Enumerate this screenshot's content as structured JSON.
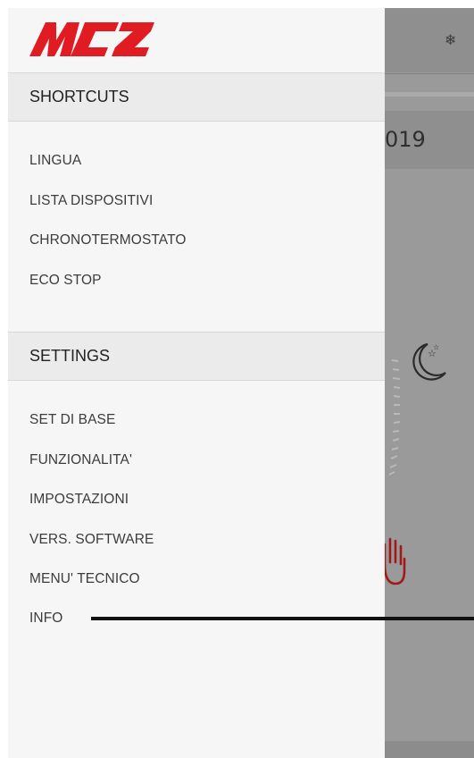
{
  "background": {
    "date_fragment": "019",
    "snow_icon": "snowflake-icon",
    "moon_icon": "moon-stars-icon",
    "hand_icon": "hand-stop-icon"
  },
  "drawer": {
    "logo_text": "MCZ",
    "brand_color": "#e11b22",
    "shortcuts": {
      "header": "SHORTCUTS",
      "items": [
        {
          "label": "LINGUA"
        },
        {
          "label": "LISTA DISPOSITIVI"
        },
        {
          "label": "CHRONOTERMOSTATO"
        },
        {
          "label": "ECO STOP"
        }
      ]
    },
    "settings": {
      "header": "SETTINGS",
      "items": [
        {
          "label": "SET DI BASE"
        },
        {
          "label": "FUNZIONALITA'"
        },
        {
          "label": "IMPOSTAZIONI"
        },
        {
          "label": "VERS. SOFTWARE"
        },
        {
          "label": "MENU' TECNICO"
        },
        {
          "label": "INFO"
        }
      ]
    }
  }
}
